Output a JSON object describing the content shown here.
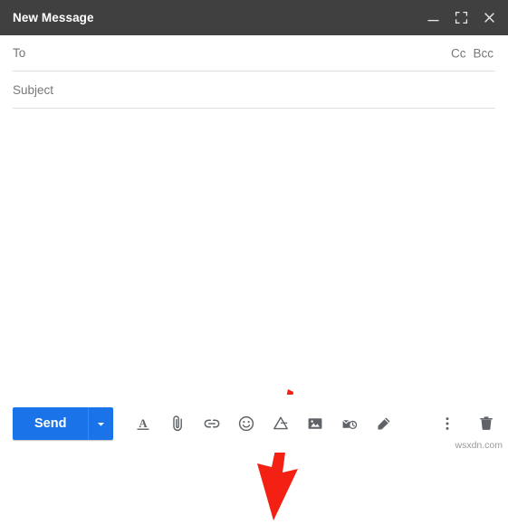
{
  "window": {
    "title": "New Message",
    "controls": [
      {
        "name": "minimize",
        "label": "Minimize"
      },
      {
        "name": "fullscreen",
        "label": "Full screen"
      },
      {
        "name": "close",
        "label": "Close"
      }
    ]
  },
  "fields": {
    "to": {
      "label": "To",
      "value": "",
      "placeholder": "To"
    },
    "cc": {
      "label": "Cc"
    },
    "bcc": {
      "label": "Bcc"
    },
    "subject": {
      "label": "Subject",
      "value": "",
      "placeholder": "Subject"
    },
    "body": {
      "value": "",
      "placeholder": ""
    }
  },
  "toolbar": {
    "send_label": "Send",
    "send_options_label": "More send options",
    "icons": [
      {
        "name": "formatting-options-icon",
        "title": "Formatting options"
      },
      {
        "name": "attach-file-icon",
        "title": "Attach files"
      },
      {
        "name": "insert-link-icon",
        "title": "Insert link"
      },
      {
        "name": "insert-emoji-icon",
        "title": "Insert emoji"
      },
      {
        "name": "insert-drive-icon",
        "title": "Insert files using Drive"
      },
      {
        "name": "insert-photo-icon",
        "title": "Insert photo"
      },
      {
        "name": "confidential-mode-icon",
        "title": "Toggle confidential mode"
      },
      {
        "name": "insert-signature-icon",
        "title": "Insert signature"
      }
    ],
    "right_icons": [
      {
        "name": "more-options-icon",
        "title": "More options"
      },
      {
        "name": "discard-draft-icon",
        "title": "Discard draft"
      }
    ]
  },
  "annotation": {
    "arrow_color": "#f32013",
    "points_to": "insert-drive-icon"
  },
  "watermark": {
    "text": "wsxdn.com"
  },
  "colors": {
    "titlebar_bg": "#404040",
    "send_blue": "#1a73e8",
    "icon_gray": "#5f6368",
    "label_gray": "#777777"
  }
}
